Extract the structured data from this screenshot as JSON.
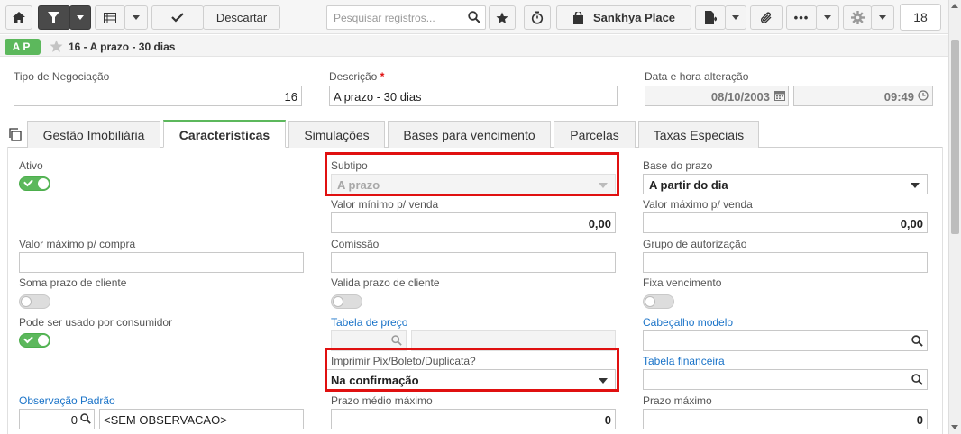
{
  "toolbar": {
    "discard_label": "Descartar",
    "search_placeholder": "Pesquisar registros...",
    "place_label": "Sankhya Place",
    "page_count": "18"
  },
  "record": {
    "badge": "AP",
    "title": "16 - A prazo - 30 dias"
  },
  "header": {
    "tipo_label": "Tipo de Negociação",
    "tipo_value": "16",
    "descricao_label": "Descrição",
    "required_mark": "*",
    "descricao_value": "A prazo - 30 dias",
    "data_label": "Data e hora alteração",
    "data_value": "08/10/2003",
    "hora_value": "09:49"
  },
  "tabs": [
    {
      "label": "Gestão Imobiliária"
    },
    {
      "label": "Características"
    },
    {
      "label": "Simulações"
    },
    {
      "label": "Bases para vencimento"
    },
    {
      "label": "Parcelas"
    },
    {
      "label": "Taxas Especiais"
    }
  ],
  "form": {
    "ativo_label": "Ativo",
    "ativo_on": true,
    "subtipo_label": "Subtipo",
    "subtipo_value": "A prazo",
    "base_prazo_label": "Base do prazo",
    "base_prazo_value": "A partir do dia",
    "valor_min_venda_label": "Valor mínimo p/ venda",
    "valor_min_venda_value": "0,00",
    "valor_max_venda_label": "Valor máximo p/ venda",
    "valor_max_venda_value": "0,00",
    "valor_max_compra_label": "Valor máximo p/ compra",
    "comissao_label": "Comissão",
    "grupo_aut_label": "Grupo de autorização",
    "soma_prazo_label": "Soma prazo de cliente",
    "valida_prazo_label": "Valida prazo de cliente",
    "fixa_venc_label": "Fixa vencimento",
    "pode_usado_label": "Pode ser usado por consumidor",
    "tabela_preco_label": "Tabela de preço",
    "cabecalho_label": "Cabeçalho modelo",
    "imprimir_label": "Imprimir Pix/Boleto/Duplicata?",
    "imprimir_value": "Na confirmação",
    "tabela_fin_label": "Tabela financeira",
    "obs_label": "Observação Padrão",
    "obs_code": "0",
    "obs_value": "<SEM OBSERVACAO>",
    "prazo_medio_label": "Prazo médio máximo",
    "prazo_medio_value": "0",
    "prazo_max_label": "Prazo máximo",
    "prazo_max_value": "0"
  },
  "colors": {
    "accent": "#5cb85c",
    "highlight": "#e01010",
    "link": "#1a73c8"
  }
}
